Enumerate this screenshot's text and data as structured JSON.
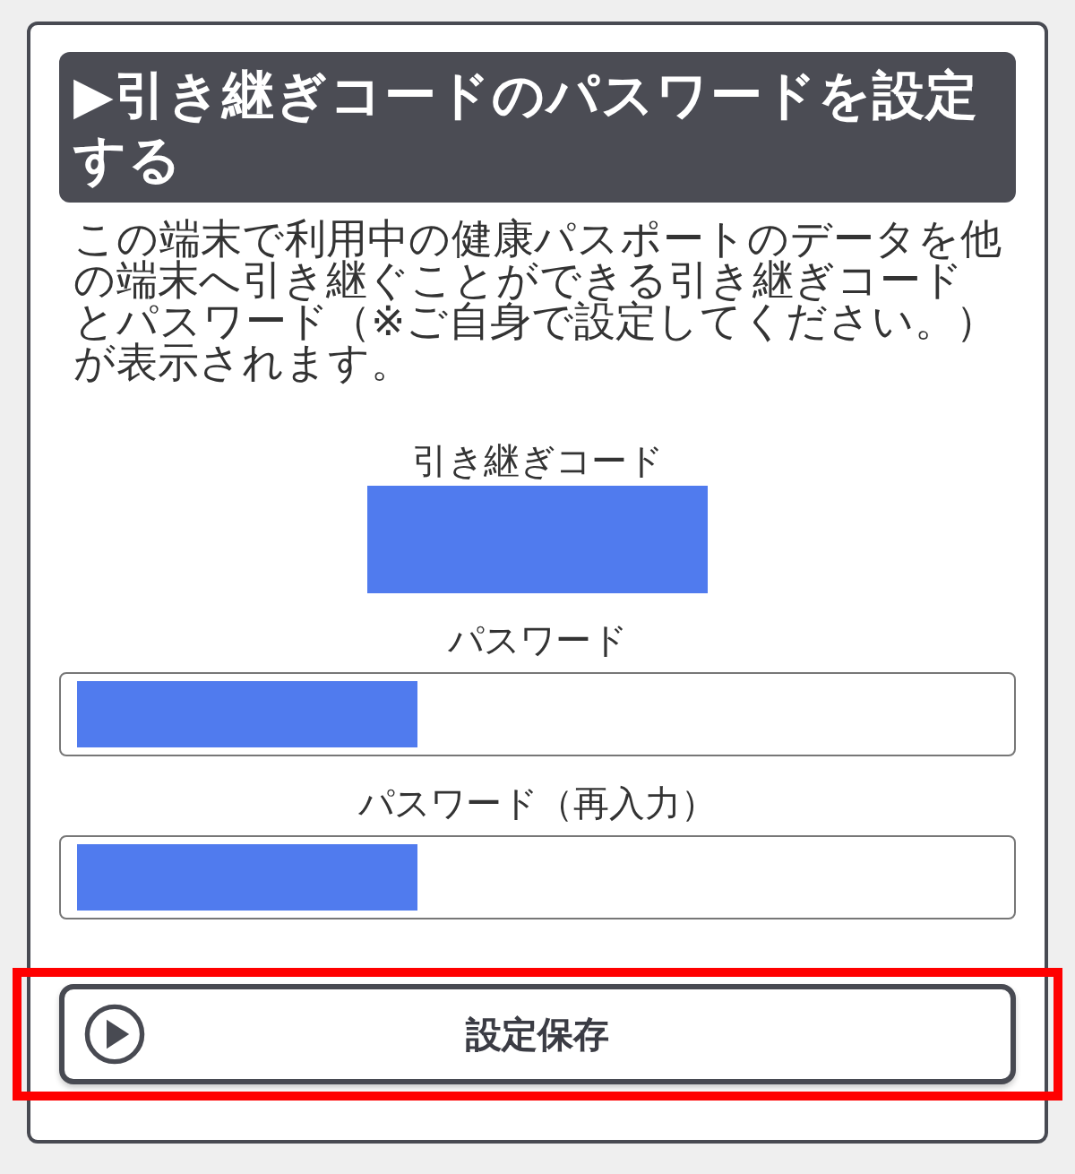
{
  "panel": {
    "title": "▶引き継ぎコードのパスワードを設定する",
    "description": "この端末で利用中の健康パスポートのデータを他の端末へ引き継ぐことができる引き継ぎコードとパスワード（※ご自身で設定してください。）が表示されます。",
    "code": {
      "label": "引き継ぎコード",
      "redacted": true
    },
    "fields": [
      {
        "label": "パスワード",
        "redacted": true
      },
      {
        "label": "パスワード（再入力）",
        "redacted": true
      }
    ],
    "save_button": {
      "label": "設定保存",
      "highlighted": true
    }
  }
}
